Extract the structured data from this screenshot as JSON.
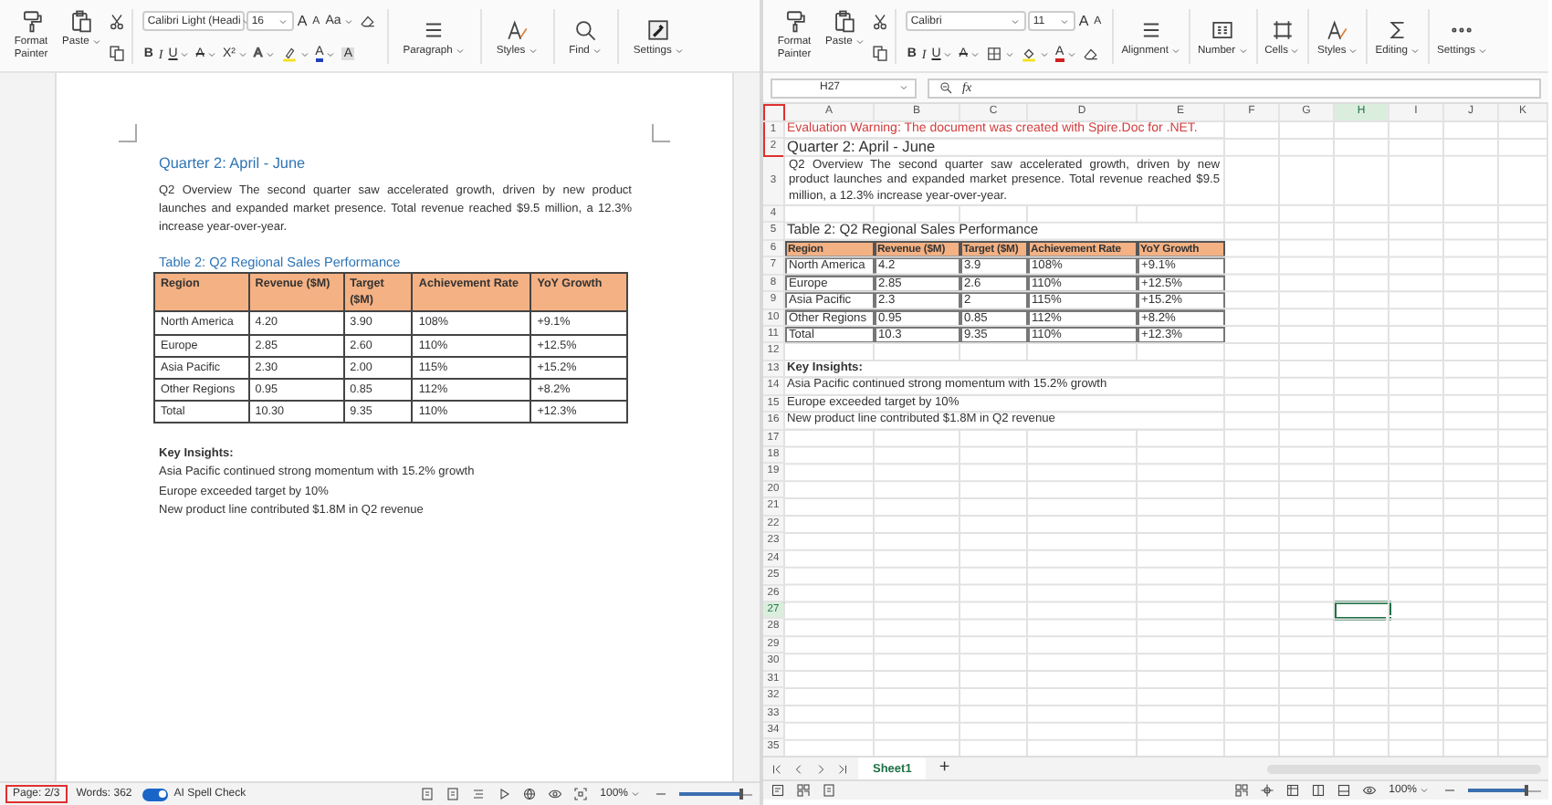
{
  "document_pane": {
    "ribbon": {
      "format_painter": "Format Painter",
      "paste": "Paste",
      "font_name": "Calibri Light (Headi",
      "font_size": "16",
      "font_buttons": [
        {
          "glyph": "A",
          "kind": "grow"
        },
        {
          "glyph": "A",
          "kind": "shrink"
        },
        {
          "glyph": "Aa",
          "kind": "case"
        },
        {
          "kind": "eraser"
        }
      ],
      "format_buttons": [
        {
          "glyph": "B",
          "kind": "bold"
        },
        {
          "glyph": "I",
          "kind": "italic"
        },
        {
          "glyph": "U",
          "kind": "underline"
        },
        {
          "glyph": "A",
          "kind": "strike"
        },
        {
          "glyph": "X²",
          "kind": "super"
        },
        {
          "glyph": "A",
          "kind": "effect"
        },
        {
          "kind": "highlight"
        },
        {
          "glyph": "A",
          "kind": "color"
        },
        {
          "glyph": "A",
          "kind": "shade"
        }
      ],
      "groups": [
        {
          "label": "Paragraph",
          "kind": "paragraph"
        },
        {
          "label": "Styles",
          "kind": "styles"
        },
        {
          "label": "Find",
          "kind": "find"
        },
        {
          "label": "Settings",
          "kind": "settings"
        }
      ]
    },
    "page": {
      "heading": "Quarter 2: April - June",
      "overview": "Q2 Overview The second quarter saw accelerated growth, driven by new product launches and expanded market presence. Total revenue reached $9.5 million, a 12.3% increase year-over-year.",
      "caption": "Table 2: Q2 Regional Sales Performance",
      "table": {
        "columns": [
          "Region",
          "Revenue ($M)",
          "Target ($M)",
          "Achievement Rate",
          "YoY Growth"
        ],
        "rows": [
          [
            "North America",
            "4.20",
            "3.90",
            "108%",
            "+9.1%"
          ],
          [
            "Europe",
            "2.85",
            "2.60",
            "110%",
            "+12.5%"
          ],
          [
            "Asia Pacific",
            "2.30",
            "2.00",
            "115%",
            "+15.2%"
          ],
          [
            "Other Regions",
            "0.95",
            "0.85",
            "112%",
            "+8.2%"
          ],
          [
            "Total",
            "10.30",
            "9.35",
            "110%",
            "+12.3%"
          ]
        ]
      },
      "insights_title": "Key Insights:",
      "insights": [
        "Asia Pacific continued strong momentum with 15.2% growth",
        "Europe exceeded target by 10%",
        "New product line contributed $1.8M in Q2 revenue"
      ]
    },
    "status_bar": {
      "page": {
        "text": "Page: 2/3",
        "highlighted": true
      },
      "words": "Words: 362",
      "spell_check": {
        "label": "AI Spell Check",
        "on": true
      },
      "zoom": "100%",
      "zoom_slider": {
        "level": 0.85
      }
    }
  },
  "spreadsheet_pane": {
    "ribbon": {
      "format_painter": "Format Painter",
      "paste": "Paste",
      "font_name": "Calibri",
      "font_size": "11",
      "font_buttons": [
        {
          "glyph": "A",
          "kind": "grow"
        },
        {
          "glyph": "A",
          "kind": "shrink"
        }
      ],
      "format_buttons": [
        {
          "glyph": "B",
          "kind": "bold"
        },
        {
          "glyph": "I",
          "kind": "italic"
        },
        {
          "glyph": "U",
          "kind": "underline"
        },
        {
          "glyph": "A",
          "kind": "strike"
        },
        {
          "kind": "borders"
        },
        {
          "kind": "fill"
        },
        {
          "glyph": "A",
          "kind": "fontcolor"
        },
        {
          "kind": "eraser"
        }
      ],
      "groups": [
        {
          "label": "Alignment",
          "kind": "alignment"
        },
        {
          "label": "Number",
          "kind": "number"
        },
        {
          "label": "Cells",
          "kind": "cells"
        },
        {
          "label": "Styles",
          "kind": "styles"
        },
        {
          "label": "Editing",
          "kind": "editing"
        },
        {
          "label": "Settings",
          "kind": "more"
        }
      ]
    },
    "formula_bar": {
      "name_box": "H27",
      "fx": "fx"
    },
    "sheet": {
      "corner_highlighted": true,
      "columns": [
        {
          "label": "A",
          "selected": false
        },
        {
          "label": "B",
          "selected": false
        },
        {
          "label": "C",
          "selected": false
        },
        {
          "label": "D",
          "selected": false
        },
        {
          "label": "E",
          "selected": false
        },
        {
          "label": "F",
          "selected": false
        },
        {
          "label": "G",
          "selected": false
        },
        {
          "label": "H",
          "selected": true
        },
        {
          "label": "I",
          "selected": false
        },
        {
          "label": "J",
          "selected": false
        },
        {
          "label": "K",
          "selected": false
        }
      ],
      "rows": [
        {
          "number": "1",
          "selected": false,
          "kind": "warning",
          "cells": [
            "Evaluation Warning: The document was created with Spire.Doc for .NET."
          ]
        },
        {
          "number": "2",
          "selected": false,
          "kind": "title",
          "cells": [
            "Quarter 2: April - June"
          ]
        },
        {
          "number": "3",
          "selected": false,
          "kind": "paragraph",
          "cells": [
            "Q2 Overview The second quarter saw accelerated growth, driven by new product launches and expanded market presence. Total revenue reached $9.5 million, a 12.3% increase year-over-year."
          ]
        },
        {
          "number": "4",
          "selected": false,
          "kind": "empty"
        },
        {
          "number": "5",
          "selected": false,
          "kind": "caption",
          "cells": [
            "Table 2: Q2 Regional Sales Performance"
          ]
        },
        {
          "number": "6",
          "selected": false,
          "kind": "table_header",
          "cells": [
            "Region",
            "Revenue ($M)",
            "Target ($M)",
            "Achievement Rate",
            "YoY Growth"
          ]
        },
        {
          "number": "7",
          "selected": false,
          "kind": "table_row",
          "cells": [
            "North America",
            "4.2",
            "3.9",
            "108%",
            "+9.1%"
          ]
        },
        {
          "number": "8",
          "selected": false,
          "kind": "table_row",
          "cells": [
            "Europe",
            "2.85",
            "2.6",
            "110%",
            "+12.5%"
          ]
        },
        {
          "number": "9",
          "selected": false,
          "kind": "table_row",
          "cells": [
            "Asia Pacific",
            "2.3",
            "2",
            "115%",
            "+15.2%"
          ]
        },
        {
          "number": "10",
          "selected": false,
          "kind": "table_row",
          "cells": [
            "Other Regions",
            "0.95",
            "0.85",
            "112%",
            "+8.2%"
          ]
        },
        {
          "number": "11",
          "selected": false,
          "kind": "table_row",
          "cells": [
            "Total",
            "10.3",
            "9.35",
            "110%",
            "+12.3%"
          ]
        },
        {
          "number": "12",
          "selected": false,
          "kind": "empty"
        },
        {
          "number": "13",
          "selected": false,
          "kind": "bold",
          "cells": [
            "Key Insights:"
          ]
        },
        {
          "number": "14",
          "selected": false,
          "kind": "text",
          "cells": [
            "Asia Pacific continued strong momentum with 15.2% growth"
          ]
        },
        {
          "number": "15",
          "selected": false,
          "kind": "text",
          "cells": [
            "Europe exceeded target by 10%"
          ]
        },
        {
          "number": "16",
          "selected": false,
          "kind": "text",
          "cells": [
            "New product line contributed $1.8M in Q2 revenue"
          ]
        },
        {
          "number": "17",
          "selected": false,
          "kind": "empty"
        },
        {
          "number": "18",
          "selected": false,
          "kind": "empty"
        },
        {
          "number": "19",
          "selected": false,
          "kind": "empty"
        },
        {
          "number": "20",
          "selected": false,
          "kind": "empty"
        },
        {
          "number": "21",
          "selected": false,
          "kind": "empty"
        },
        {
          "number": "22",
          "selected": false,
          "kind": "empty"
        },
        {
          "number": "23",
          "selected": false,
          "kind": "empty"
        },
        {
          "number": "24",
          "selected": false,
          "kind": "empty"
        },
        {
          "number": "25",
          "selected": false,
          "kind": "empty"
        },
        {
          "number": "26",
          "selected": false,
          "kind": "empty"
        },
        {
          "number": "27",
          "selected": true,
          "kind": "empty"
        },
        {
          "number": "28",
          "selected": false,
          "kind": "empty"
        },
        {
          "number": "29",
          "selected": false,
          "kind": "empty"
        },
        {
          "number": "30",
          "selected": false,
          "kind": "empty"
        },
        {
          "number": "31",
          "selected": false,
          "kind": "empty"
        },
        {
          "number": "32",
          "selected": false,
          "kind": "empty"
        },
        {
          "number": "33",
          "selected": false,
          "kind": "empty"
        },
        {
          "number": "34",
          "selected": false,
          "kind": "empty"
        },
        {
          "number": "35",
          "selected": false,
          "kind": "empty"
        }
      ]
    },
    "tabs": [
      {
        "label": "Sheet1",
        "selected": true
      }
    ],
    "add_tab": "+",
    "status_bar": {
      "zoom": "100%",
      "zoom_slider": {
        "level": 0.8
      }
    }
  }
}
